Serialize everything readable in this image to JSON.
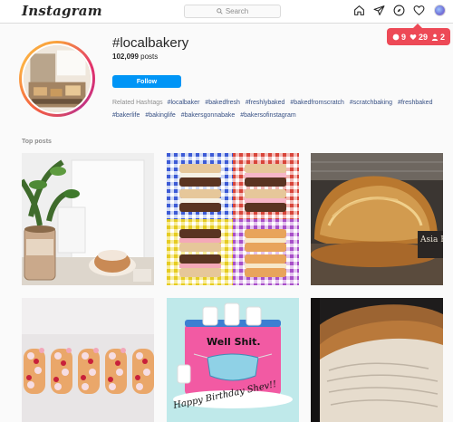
{
  "app": {
    "logo_text": "Instagram"
  },
  "search": {
    "placeholder": "Search"
  },
  "nav": {
    "icons": [
      "home-icon",
      "direct-icon",
      "explore-icon",
      "heart-icon",
      "profile-avatar"
    ]
  },
  "notifications": {
    "comments": "9",
    "likes": "29",
    "follows": "2"
  },
  "hashtag": {
    "title": "#localbakery",
    "posts_count": "102,099",
    "posts_label": "posts",
    "follow_label": "Follow",
    "related_label": "Related Hashtags",
    "related": [
      "#localbaker",
      "#bakedfresh",
      "#freshlybaked",
      "#bakedfromscratch",
      "#scratchbaking",
      "#freshbaked",
      "#bakerlife",
      "#bakinglife",
      "#bakersgonnabake",
      "#bakersofinstagram"
    ]
  },
  "section": {
    "top_posts_label": "Top posts"
  },
  "posts": [
    {
      "alt": "latte-and-pastry"
    },
    {
      "alt": "sandwich-cookies-grid"
    },
    {
      "alt": "sourdough-bread"
    },
    {
      "alt": "letter-cake"
    },
    {
      "alt": "birthday-cake"
    },
    {
      "alt": "rustic-loaf"
    }
  ],
  "post_text": {
    "post3_sign": "Asia B",
    "post5_cake_text": "Well Shit.",
    "post5_board_text": "Happy Birthday Shev!!"
  },
  "colors": {
    "accent": "#0095f6",
    "badge": "#ed4956",
    "link": "#385185"
  }
}
